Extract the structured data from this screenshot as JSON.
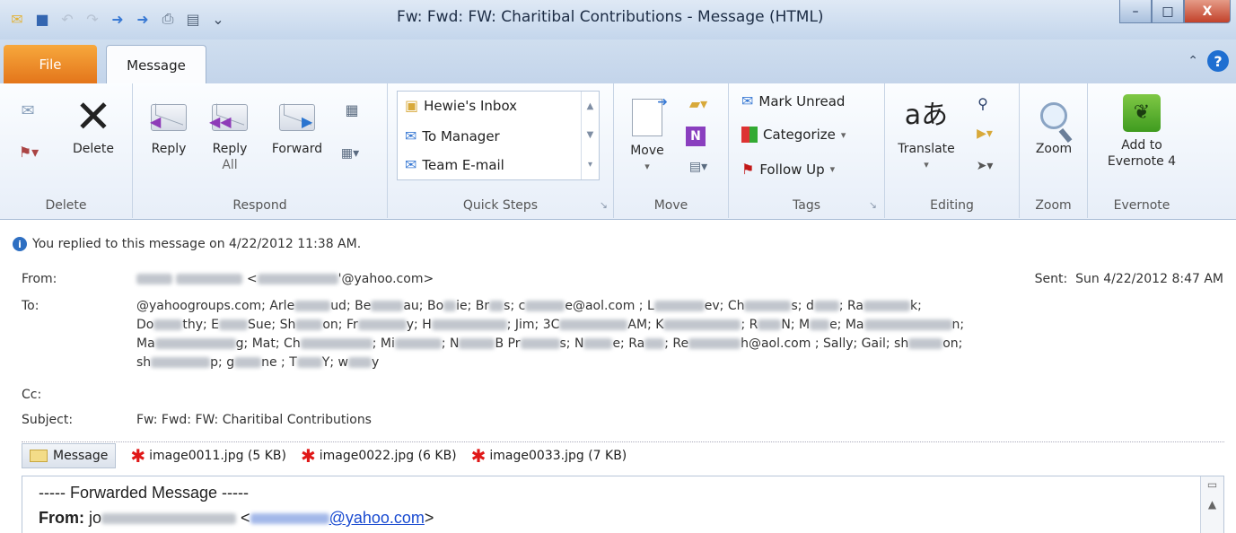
{
  "window": {
    "title": "Fw: Fwd: FW: Charitibal Contributions  -  Message (HTML)",
    "controls": {
      "minimize": "–",
      "maximize": "□",
      "close": "X"
    }
  },
  "tabs": {
    "file": "File",
    "message": "Message"
  },
  "ribbon": {
    "delete_group": {
      "label": "Delete",
      "delete": "Delete"
    },
    "respond_group": {
      "label": "Respond",
      "reply": "Reply",
      "reply_all_line1": "Reply",
      "reply_all_line2": "All",
      "forward": "Forward"
    },
    "quick_steps": {
      "label": "Quick Steps",
      "items": [
        "Hewie's Inbox",
        "To Manager",
        "Team E-mail"
      ]
    },
    "move_group": {
      "label": "Move",
      "move": "Move"
    },
    "tags_group": {
      "label": "Tags",
      "mark_unread": "Mark Unread",
      "categorize": "Categorize",
      "follow_up": "Follow Up"
    },
    "editing_group": {
      "label": "Editing",
      "translate": "Translate"
    },
    "zoom_group": {
      "label": "Zoom",
      "zoom": "Zoom"
    },
    "evernote_group": {
      "label": "Evernote",
      "add_line1": "Add to",
      "add_line2": "Evernote 4"
    }
  },
  "info_bar": "You replied to this message on 4/22/2012 11:38 AM.",
  "header": {
    "from_label": "From:",
    "from_value_suffix": "'@yahoo.com>",
    "to_label": "To:",
    "to_line1_a": "@yahoogroups.com; Arle",
    "to_line1_b": "ud; Be",
    "to_line1_c": "au; Bo",
    "to_line1_d": "ie; Br",
    "to_line1_e": "s; c",
    "to_line1_f": "e@aol.com   ; L",
    "to_line1_g": "ev; Ch",
    "to_line1_h": "s; d",
    "to_line1_i": "; Ra",
    "to_line1_j": "k;",
    "to_line2_a": "Do",
    "to_line2_b": "thy; E",
    "to_line2_c": "Sue; Sh",
    "to_line2_d": "on; Fr",
    "to_line2_e": "y; H",
    "to_line2_f": "; Jim; 3C",
    "to_line2_g": "AM; K",
    "to_line2_h": "; R",
    "to_line2_i": "N; M",
    "to_line2_j": "e; Ma",
    "to_line2_k": "n;",
    "to_line3_a": "Ma",
    "to_line3_b": "g; Mat; Ch",
    "to_line3_c": "; Mi",
    "to_line3_d": "; N",
    "to_line3_e": "B   Pr",
    "to_line3_f": "s; N",
    "to_line3_g": "e; Ra",
    "to_line3_h": "; Re",
    "to_line3_i": "h@aol.com   ; Sally; Gail; sh",
    "to_line3_j": "on;",
    "to_line4_a": "sh",
    "to_line4_b": "p; g",
    "to_line4_c": "ne   ; T",
    "to_line4_d": "Y; w",
    "to_line4_e": "y",
    "cc_label": "Cc:",
    "subject_label": "Subject:",
    "subject_value": "Fw: Fwd: FW: Charitibal Contributions",
    "sent_label": "Sent:",
    "sent_value": "Sun 4/22/2012 8:47 AM"
  },
  "attachments": {
    "message_tab": "Message",
    "files": [
      "image0011.jpg (5 KB)",
      "image0022.jpg (6 KB)",
      "image0033.jpg (7 KB)"
    ]
  },
  "body": {
    "forwarded": "----- Forwarded Message -----",
    "from_label": "From:",
    "from_prefix": "jo",
    "from_email_suffix": "@yahoo.com",
    "lt": "<",
    "gt": ">"
  },
  "colors": {
    "file_tab": "#e3741a",
    "accent_blue": "#1f6fd1",
    "error_red": "#e01818"
  }
}
